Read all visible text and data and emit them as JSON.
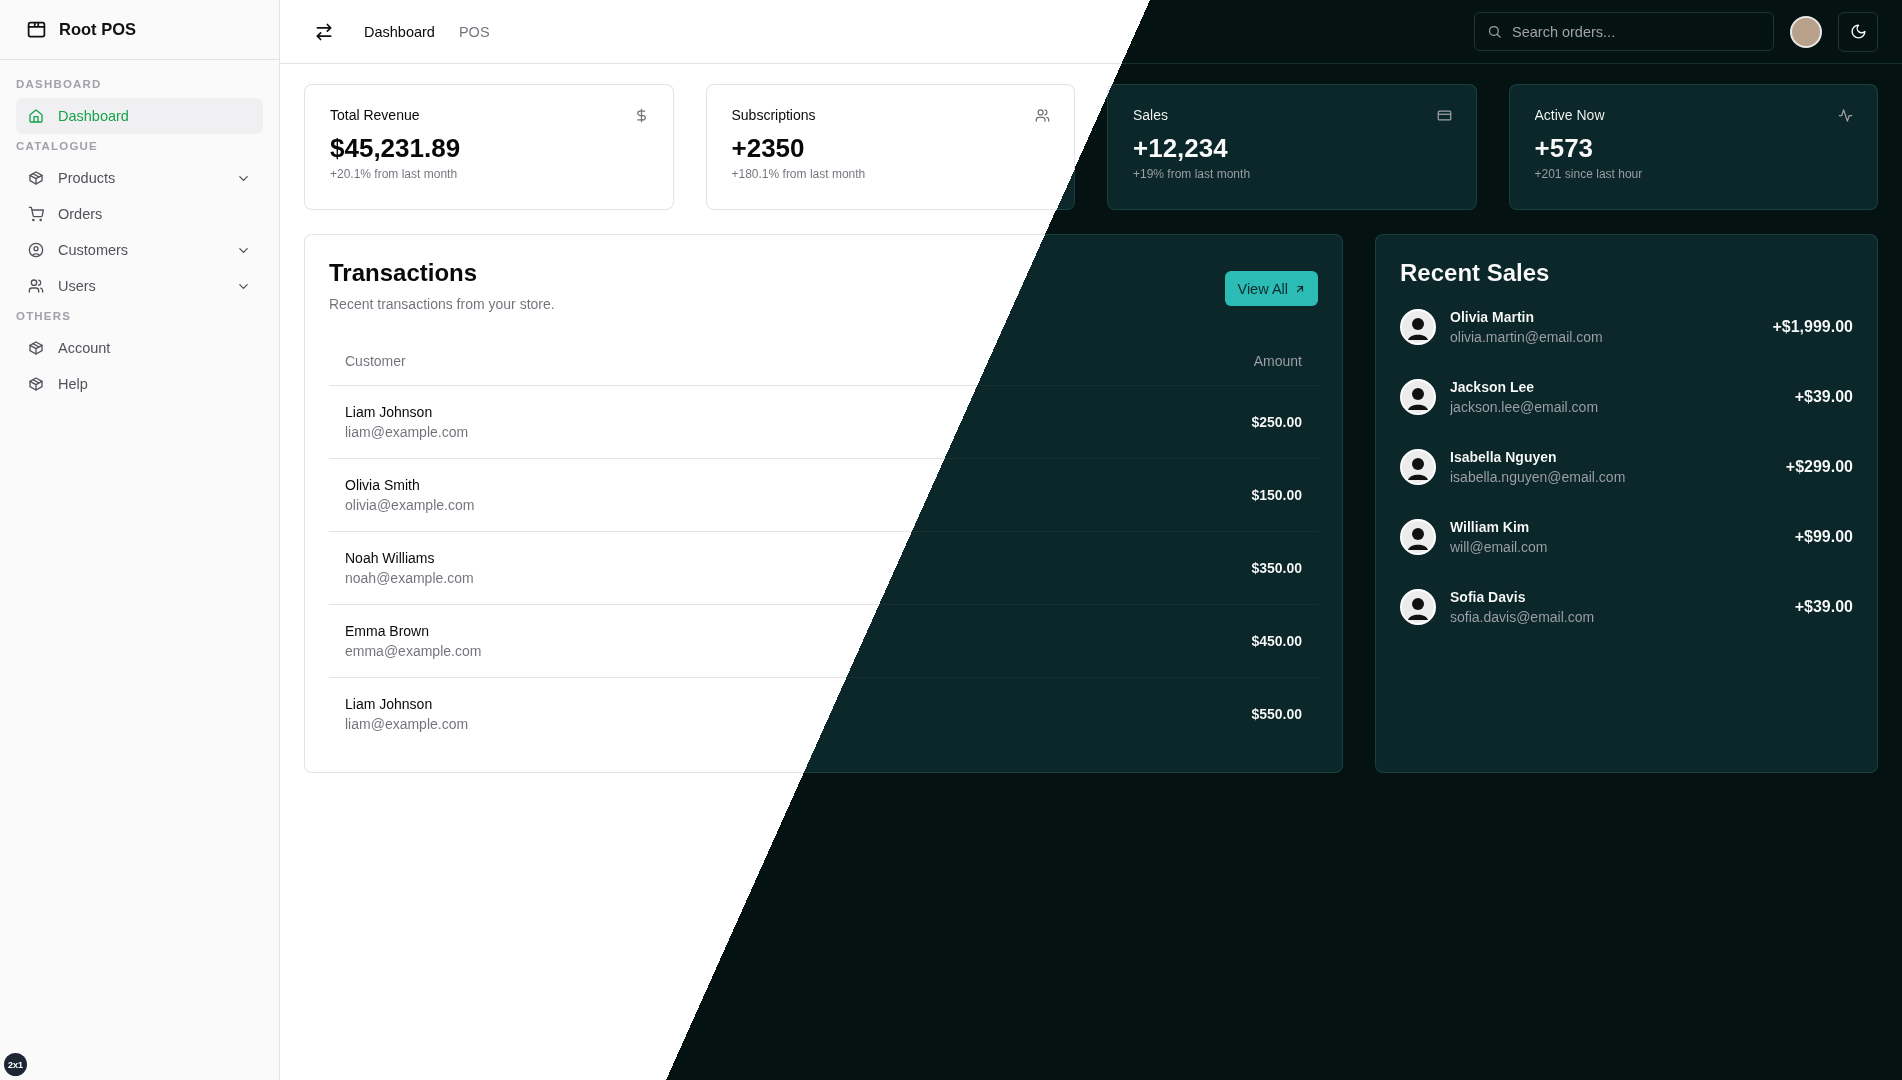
{
  "sidebar": {
    "brand": "Root POS",
    "sections": [
      {
        "label": "DASHBOARD",
        "items": [
          {
            "label": "Dashboard",
            "kind": "home",
            "selected": true,
            "expandable": false
          }
        ]
      },
      {
        "label": "CATALOGUE",
        "items": [
          {
            "label": "Products",
            "kind": "package",
            "selected": false,
            "expandable": true
          },
          {
            "label": "Orders",
            "kind": "cart",
            "selected": false,
            "expandable": false
          },
          {
            "label": "Customers",
            "kind": "person",
            "selected": false,
            "expandable": true
          },
          {
            "label": "Users",
            "kind": "people",
            "selected": false,
            "expandable": true
          }
        ]
      },
      {
        "label": "OTHERS",
        "items": [
          {
            "label": "Account",
            "kind": "package",
            "selected": false,
            "expandable": false
          },
          {
            "label": "Help",
            "kind": "package",
            "selected": false,
            "expandable": false
          }
        ]
      }
    ]
  },
  "header": {
    "nav": [
      {
        "label": "Dashboard",
        "selected": true
      },
      {
        "label": "POS",
        "selected": false
      }
    ],
    "search": {
      "placeholder": "Search orders..."
    }
  },
  "stats": [
    {
      "title": "Total Revenue",
      "value": "$45,231.89",
      "note": "+20.1% from last month",
      "kind": "revenue"
    },
    {
      "title": "Subscriptions",
      "value": "+2350",
      "note": "+180.1% from last month",
      "kind": "subscriptions"
    },
    {
      "title": "Sales",
      "value": "+12,234",
      "note": "+19% from last month",
      "kind": "sales"
    },
    {
      "title": "Active Now",
      "value": "+573",
      "note": "+201 since last hour",
      "kind": "activity"
    }
  ],
  "transactions": {
    "title": "Transactions",
    "subtitle": "Recent transactions from your store.",
    "button": "View All",
    "columns": [
      "Customer",
      "Amount"
    ],
    "rows": [
      {
        "name": "Liam Johnson",
        "email": "liam@example.com",
        "amount": "$250.00"
      },
      {
        "name": "Olivia Smith",
        "email": "olivia@example.com",
        "amount": "$150.00"
      },
      {
        "name": "Noah Williams",
        "email": "noah@example.com",
        "amount": "$350.00"
      },
      {
        "name": "Emma Brown",
        "email": "emma@example.com",
        "amount": "$450.00"
      },
      {
        "name": "Liam Johnson",
        "email": "liam@example.com",
        "amount": "$550.00"
      }
    ]
  },
  "recent_sales": {
    "title": "Recent Sales",
    "items": [
      {
        "name": "Olivia Martin",
        "email": "olivia.martin@email.com",
        "amount": "+$1,999.00"
      },
      {
        "name": "Jackson Lee",
        "email": "jackson.lee@email.com",
        "amount": "+$39.00"
      },
      {
        "name": "Isabella Nguyen",
        "email": "isabella.nguyen@email.com",
        "amount": "+$299.00"
      },
      {
        "name": "William Kim",
        "email": "will@email.com",
        "amount": "+$99.00"
      },
      {
        "name": "Sofia Davis",
        "email": "sofia.davis@email.com",
        "amount": "+$39.00"
      }
    ]
  },
  "corner_badge": "2x1"
}
